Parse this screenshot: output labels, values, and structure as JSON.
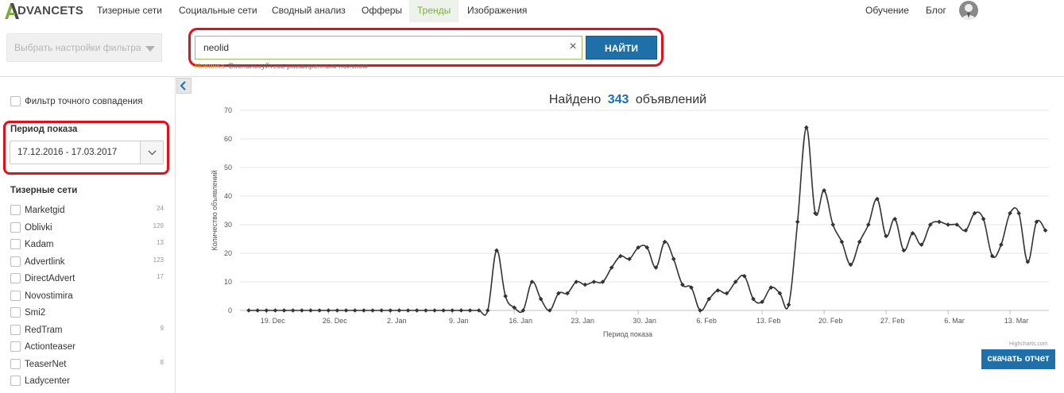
{
  "brand": {
    "logo_text": "DVANCETS"
  },
  "nav": {
    "items": [
      {
        "label": "Тизерные сети"
      },
      {
        "label": "Социальные сети"
      },
      {
        "label": "Сводный анализ"
      },
      {
        "label": "Офферы"
      },
      {
        "label": "Тренды",
        "active": true
      },
      {
        "label": "Изображения"
      }
    ],
    "right": [
      {
        "label": "Обучение"
      },
      {
        "label": "Блог"
      }
    ]
  },
  "filter": {
    "label": "Выбрать настройки фильтра"
  },
  "search": {
    "value": "neolid",
    "clear_icon": "×",
    "button": "НАЙТИ",
    "hint_new": "Новинка:",
    "hint_text": "Воспользуйтесь расширенным поиском"
  },
  "sidebar": {
    "exact_match": "Фильтр точного совпадения",
    "period_title": "Период показа",
    "period_value": "17.12.2016 - 17.03.2017",
    "networks_title": "Тизерные сети",
    "networks": [
      {
        "name": "Marketgid",
        "count": "24"
      },
      {
        "name": "Oblivki",
        "count": "129"
      },
      {
        "name": "Kadam",
        "count": "13"
      },
      {
        "name": "Advertlink",
        "count": "123"
      },
      {
        "name": "DirectAdvert",
        "count": "17"
      },
      {
        "name": "Novostimira",
        "count": ""
      },
      {
        "name": "Smi2",
        "count": ""
      },
      {
        "name": "RedTram",
        "count": "9"
      },
      {
        "name": "Actionteaser",
        "count": ""
      },
      {
        "name": "TeaserNet",
        "count": "8"
      },
      {
        "name": "Ladycenter",
        "count": ""
      }
    ]
  },
  "chart_data": {
    "type": "line",
    "title_prefix": "Найдено",
    "title_count": "343",
    "title_suffix": "объявлений",
    "xlabel": "Период показа",
    "ylabel": "Количество объявлений",
    "ylim": [
      0,
      70
    ],
    "yticks": [
      0,
      10,
      20,
      30,
      40,
      50,
      60,
      70
    ],
    "xtick_labels": [
      "19. Dec",
      "26. Dec",
      "2. Jan",
      "9. Jan",
      "16. Jan",
      "23. Jan",
      "30. Jan",
      "6. Feb",
      "13. Feb",
      "20. Feb",
      "27. Feb",
      "6. Mar",
      "13. Mar"
    ],
    "grid": true,
    "color": "#333333",
    "start_date": "2016-12-17",
    "values": [
      0,
      0,
      0,
      0,
      0,
      0,
      0,
      0,
      0,
      0,
      0,
      0,
      0,
      0,
      0,
      0,
      0,
      0,
      0,
      0,
      0,
      0,
      0,
      0,
      0,
      0,
      0,
      0,
      21,
      5,
      1,
      0,
      10,
      4,
      0,
      6,
      6,
      10,
      9,
      10,
      10,
      15,
      19,
      18,
      22,
      22,
      15,
      24,
      18,
      9,
      8,
      0,
      4,
      7,
      6,
      10,
      12,
      4,
      3,
      8,
      6,
      2,
      31,
      64,
      34,
      42,
      30,
      24,
      16,
      24,
      30,
      39,
      26,
      32,
      21,
      27,
      23,
      30,
      31,
      30,
      30,
      28,
      34,
      32,
      19,
      23,
      34,
      34,
      17,
      31,
      28
    ],
    "credits": "Highcharts.com",
    "download_label": "скачать отчет"
  }
}
